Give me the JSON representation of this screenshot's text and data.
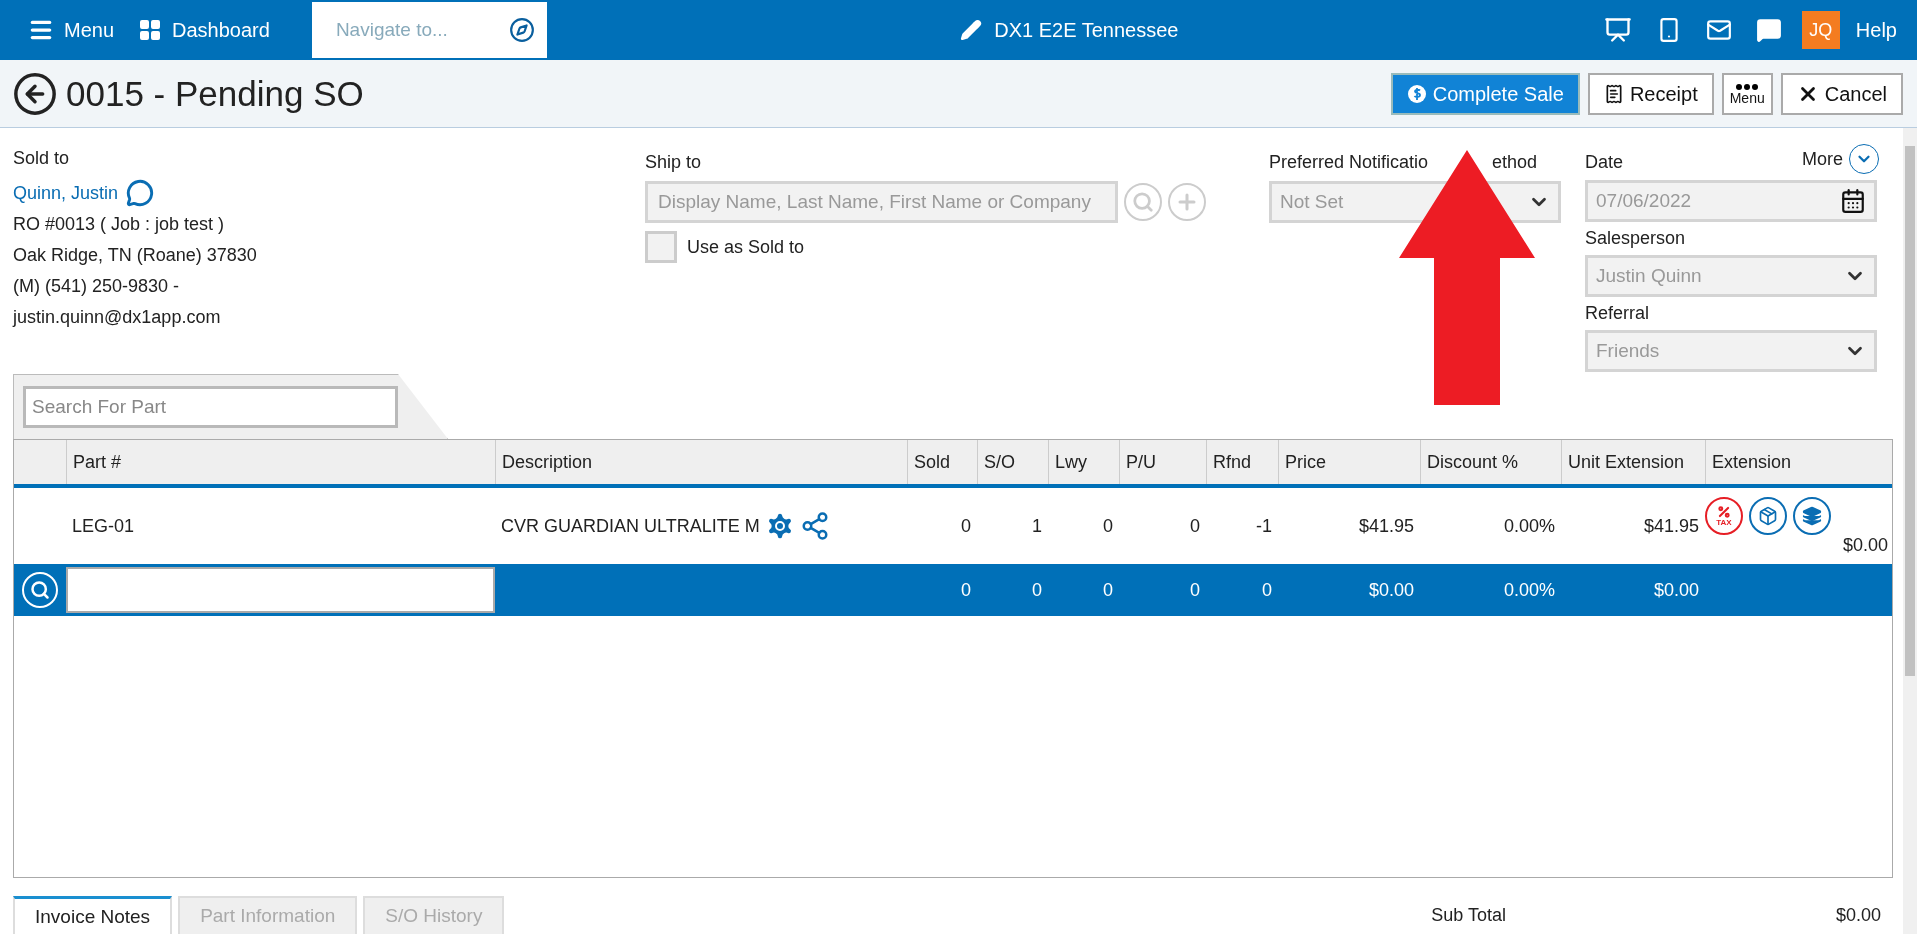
{
  "top_bar": {
    "menu": "Menu",
    "dashboard": "Dashboard",
    "navigate_placeholder": "Navigate to...",
    "location": "DX1 E2E Tennessee",
    "avatar": "JQ",
    "help": "Help"
  },
  "header": {
    "title": "0015 - Pending SO",
    "buttons": [
      {
        "label": "Complete Sale",
        "kind": "primary"
      },
      {
        "label": "Receipt",
        "kind": "receipt"
      },
      {
        "label": "Menu",
        "kind": "menu"
      },
      {
        "label": "Cancel",
        "kind": "cancel"
      }
    ]
  },
  "sold_to": {
    "label": "Sold to",
    "name": "Quinn, Justin",
    "lines": [
      "RO #0013 ( Job : job test )",
      "Oak Ridge, TN (Roane) 37830",
      "(M) (541) 250-9830 -",
      "justin.quinn@dx1app.com"
    ]
  },
  "ship_to": {
    "label": "Ship to",
    "placeholder": "Display Name, Last Name, First Name or Company",
    "use_as_sold_to": {
      "label": "Use as Sold to",
      "checked": false
    }
  },
  "notification": {
    "label_parts": [
      "Preferred Notificatio",
      "ethod"
    ],
    "value": "Not Set"
  },
  "more": "More",
  "date": {
    "label": "Date",
    "value": "07/06/2022"
  },
  "salesperson": {
    "label": "Salesperson",
    "value": "Justin Quinn"
  },
  "referral": {
    "label": "Referral",
    "value": "Friends"
  },
  "part_search": {
    "placeholder": "Search For Part"
  },
  "table": {
    "columns": [
      "Part #",
      "Description",
      "Sold",
      "S/O",
      "Lwy",
      "P/U",
      "Rfnd",
      "Price",
      "Discount %",
      "Unit Extension",
      "Extension"
    ],
    "rows": [
      {
        "part": "LEG-01",
        "description": "CVR GUARDIAN ULTRALITE M",
        "sold": "0",
        "so": "1",
        "lwy": "0",
        "pu": "0",
        "rfnd": "-1",
        "price": "$41.95",
        "discount": "0.00%",
        "unit_extension": "$41.95",
        "tax_label": "TAX",
        "extension": "$0.00"
      }
    ],
    "entry_row": {
      "sold": "0",
      "so": "0",
      "lwy": "0",
      "pu": "0",
      "rfnd": "0",
      "price": "$0.00",
      "discount": "0.00%",
      "unit_extension": "$0.00"
    }
  },
  "bottom_tabs": [
    {
      "label": "Invoice Notes",
      "selected": true
    },
    {
      "label": "Part Information",
      "selected": false
    },
    {
      "label": "S/O History",
      "selected": false
    }
  ],
  "sub_total": {
    "label": "Sub Total",
    "value": "$0.00"
  },
  "annotation": {
    "kind": "arrow",
    "color": "#ed1c24"
  }
}
